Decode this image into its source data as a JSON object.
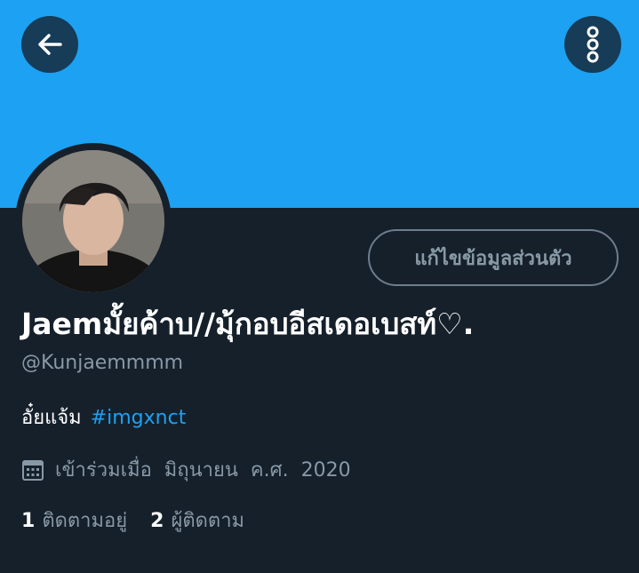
{
  "header": {
    "back_icon": "arrow-left-icon",
    "more_icon": "more-vertical-icon",
    "banner_color": "#1da1f2",
    "button_bg": "#15202b"
  },
  "profile": {
    "edit_label": "แก้ไขข้อมูลส่วนตัว",
    "display_name": "Jaemมั้ยค้าบ//มุ้กอบอีสเดอเบสท์♡.",
    "handle": "@Kunjaemmmm",
    "bio_text": "อั๋ยแจ้ม",
    "bio_hashtag": "#imgxnct",
    "joined_icon": "calendar-icon",
    "joined_text": "เข้าร่วมเมื่อ  มิถุนายน  ค.ศ.  2020",
    "following_count": "1",
    "following_label": "ติดตามอยู่",
    "followers_count": "2",
    "followers_label": "ผู้ติดตาม"
  },
  "colors": {
    "background": "#15202b",
    "accent": "#1da1f2",
    "secondary_text": "#8899a6",
    "primary_text": "#ffffff"
  }
}
